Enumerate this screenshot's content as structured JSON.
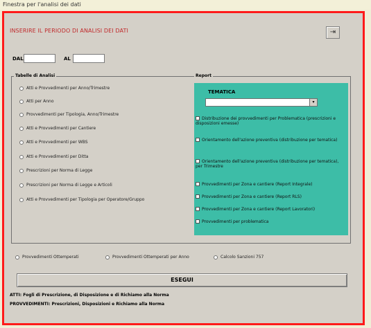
{
  "window": {
    "caption": "Finestra per l'analisi dei dati"
  },
  "header": {
    "title": "INSERIRE IL PERIODO DI ANALISI DEI DATI",
    "help_icon": "exit-door-icon"
  },
  "period": {
    "dal_label": "DAL",
    "al_label": "AL",
    "dal_value": "",
    "al_value": ""
  },
  "tabelle": {
    "legend": "Tabelle di Analisi",
    "options": [
      "Atti e Provvedimenti per Anno/Trimestre",
      "Atti per Anno",
      "Provvedimenti per Tipologia, Anno/Trimestre",
      "Atti e Provvedimenti per Cantiere",
      "Atti e Provvedimenti per WBS",
      "Atti e Provvedimenti per Ditta",
      "Prescrizioni per Norma di Legge",
      "Prescrizioni per Norma di Legge e Articoli",
      "Atti e Provvedimenti per Tipologia per Operatore/Gruppo"
    ]
  },
  "report": {
    "legend": "Report",
    "tematica_label": "TEMATICA",
    "tematica_value": "",
    "checks": [
      "Distribuzione dei provvedimenti per Problematica (prescrizioni e disposizioni emesse)",
      "Orientamento dell'azione preventiva (distribuzione per tematica)",
      "Orientamento dell'azione preventiva (distribuzione per tematica), per Trimestre",
      "Provvedimenti per Zona e cantiere (Report Integrale)",
      "Provvedimenti per Zona e cantiere (Report RLS)",
      "Provvedimenti per Zona e cantiere (Report Lavoratori)",
      "Provvedimenti per problematica"
    ]
  },
  "bottom_options": [
    "Provvedimenti Ottemperati",
    "Provvedimenti Ottemperati per Anno",
    "Calcolo Sanzioni 757"
  ],
  "execute_label": "ESEGUI",
  "notes": [
    "ATTI: Fogli di Prescrizione, di Disposizione e di Richiamo alla Norma",
    "PROVVEDIMENTI: Prescrizioni, Disposizioni e Richiamo alla Norma"
  ]
}
